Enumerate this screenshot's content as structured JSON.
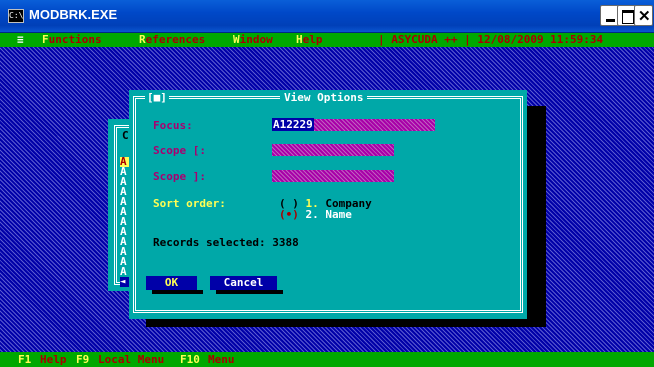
{
  "window": {
    "title": "MODBRK.EXE",
    "icon": "console-icon",
    "icon_text": "C:\\"
  },
  "menubar": {
    "system": "≡",
    "items": [
      {
        "hot": "F",
        "rest": "unctions"
      },
      {
        "hot": "R",
        "rest": "eferences"
      },
      {
        "hot": "W",
        "rest": "indow"
      },
      {
        "hot": "H",
        "rest": "elp"
      }
    ],
    "status": "| ASYCUDA ++ | 12/08/2009 11:59:34"
  },
  "background_window": {
    "header": "C",
    "rows": [
      "A",
      "A",
      "A",
      "A",
      "A",
      "A",
      "A",
      "A",
      "A",
      "A",
      "A",
      "A"
    ],
    "scroll_glyph": "◄"
  },
  "dialog": {
    "close_box": "[■]",
    "title": "View Options",
    "focus": {
      "label": "Focus:",
      "value": "A12229"
    },
    "scope_start": {
      "label": "Scope [:",
      "value": ""
    },
    "scope_end": {
      "label": "Scope ]:",
      "value": ""
    },
    "sort_order": {
      "label": "Sort order:",
      "options": [
        {
          "mark": "( )",
          "num": "1.",
          "text": "Company",
          "selected": false
        },
        {
          "mark": "(•)",
          "num": "2.",
          "text": "Name",
          "selected": true
        }
      ]
    },
    "records_selected": "Records selected: 3388",
    "ok_label": "OK",
    "cancel_label": "Cancel"
  },
  "statusbar": [
    {
      "key": "F1",
      "desc": "Help"
    },
    {
      "key": "F9",
      "desc": "Local Menu"
    },
    {
      "key": "F10",
      "desc": "Menu"
    }
  ],
  "colors": {
    "desktop": "#0000a8",
    "menubar": "#00a800",
    "dialog": "#00a8a8",
    "hotkey": "#fffe54",
    "menu_text": "#a80000",
    "label": "#a80070"
  }
}
